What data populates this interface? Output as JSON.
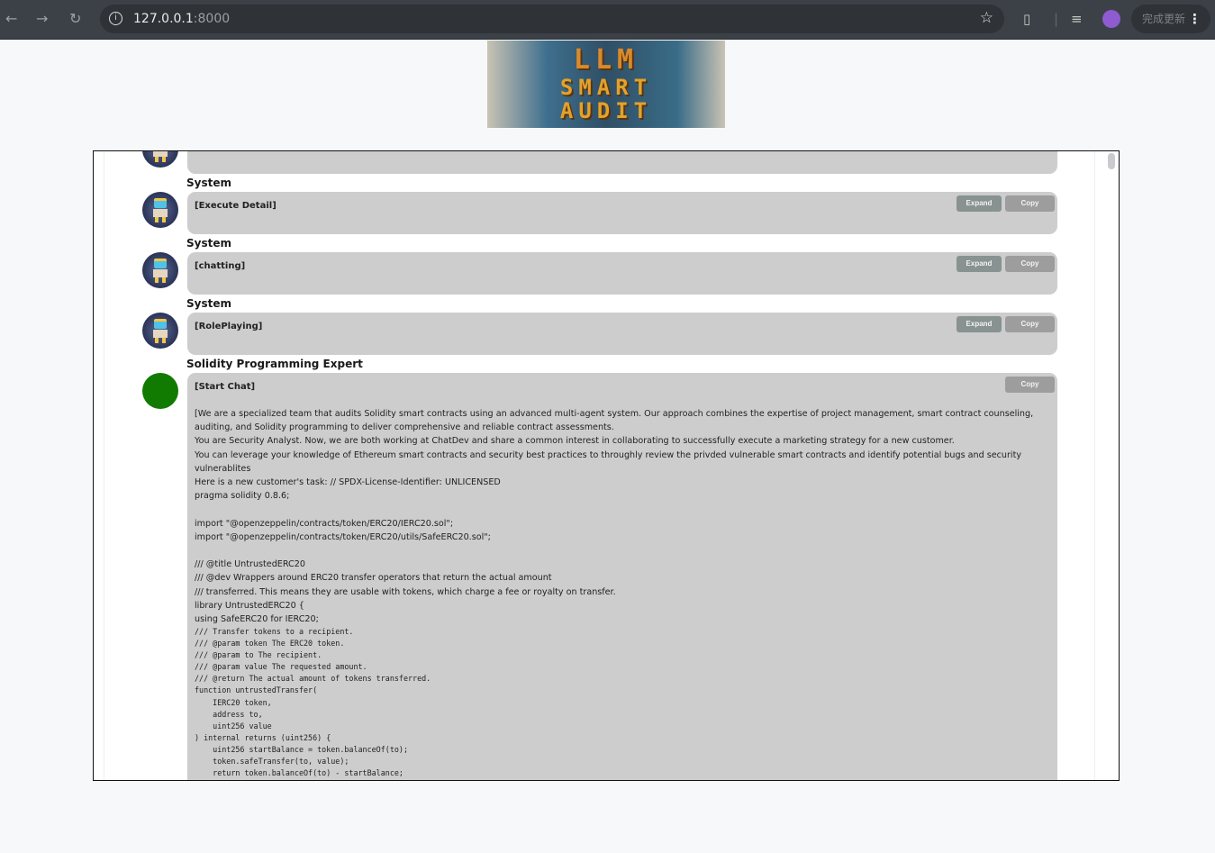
{
  "browser": {
    "url_host": "127.0.0.1",
    "url_port": ":8000",
    "update_label": "完成更新",
    "back": "←",
    "forward": "→",
    "reload": "↻",
    "star": "☆"
  },
  "logo": {
    "text_line1": "LLM",
    "text_line2": "SMART",
    "text_line3": "AUDIT"
  },
  "messages": [
    {
      "name": "System",
      "title": "[Execute Detail]",
      "expand": "Expand",
      "copy": "Copy"
    },
    {
      "name": "System",
      "title": "[chatting]",
      "expand": "Expand",
      "copy": "Copy"
    },
    {
      "name": "System",
      "title": "[RolePlaying]",
      "expand": "Expand",
      "copy": "Copy"
    },
    {
      "name": "Solidity Programming Expert",
      "title": "[Start Chat]",
      "copy": "Copy",
      "text": "[We are a specialized team that audits Solidity smart contracts using an advanced multi-agent system. Our approach combines the expertise of project management, smart contract counseling, auditing, and Solidity programming to deliver comprehensive and reliable contract assessments.\nYou are Security Analyst. Now, we are both working at ChatDev and share a common interest in collaborating to successfully execute a marketing strategy for a new customer.\nYou can leverage your knowledge of Ethereum smart contracts and security best practices to throughly review the privded vulnerable smart contracts and identify potential bugs and security vulnerablites\nHere is a new customer's task: // SPDX-License-Identifier: UNLICENSED\npragma solidity 0.8.6;\n\nimport \"@openzeppelin/contracts/token/ERC20/IERC20.sol\";\nimport \"@openzeppelin/contracts/token/ERC20/utils/SafeERC20.sol\";\n\n/// @title UntrustedERC20\n/// @dev Wrappers around ERC20 transfer operators that return the actual amount\n/// transferred. This means they are usable with tokens, which charge a fee or royalty on transfer.\nlibrary UntrustedERC20 {\nusing SafeERC20 for IERC20;",
      "code": "/// Transfer tokens to a recipient.\n/// @param token The ERC20 token.\n/// @param to The recipient.\n/// @param value The requested amount.\n/// @return The actual amount of tokens transferred.\nfunction untrustedTransfer(\n    IERC20 token,\n    address to,\n    uint256 value\n) internal returns (uint256) {\n    uint256 startBalance = token.balanceOf(to);\n    token.safeTransfer(to, value);\n    return token.balanceOf(to) - startBalance;"
    }
  ]
}
